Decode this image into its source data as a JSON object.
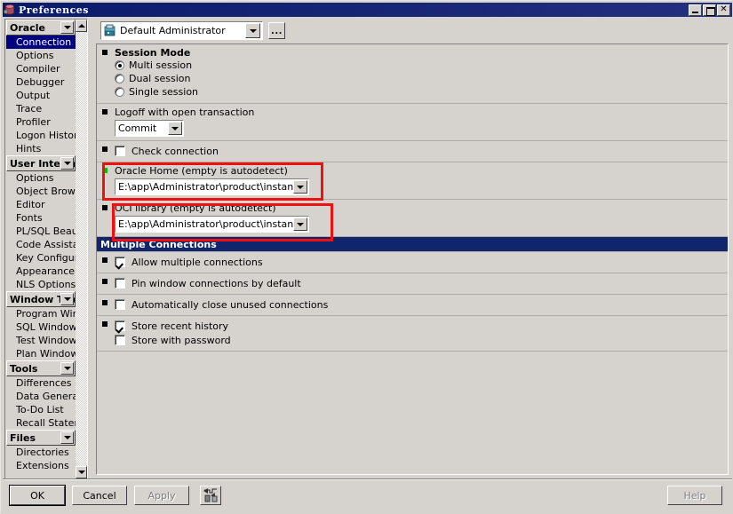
{
  "window": {
    "title": "Preferences",
    "icon": "database-icon",
    "controls": {
      "minimize": "minimize-icon",
      "maximize": "maximize-icon",
      "close": "close-icon"
    }
  },
  "sidebar": {
    "groups": [
      {
        "label": "Oracle",
        "items": [
          {
            "label": "Connection",
            "selected": true
          },
          {
            "label": "Options",
            "selected": false
          },
          {
            "label": "Compiler",
            "selected": false
          },
          {
            "label": "Debugger",
            "selected": false
          },
          {
            "label": "Output",
            "selected": false
          },
          {
            "label": "Trace",
            "selected": false
          },
          {
            "label": "Profiler",
            "selected": false
          },
          {
            "label": "Logon History",
            "selected": false
          },
          {
            "label": "Hints",
            "selected": false
          }
        ]
      },
      {
        "label": "User Interfa",
        "items": [
          {
            "label": "Options",
            "selected": false
          },
          {
            "label": "Object Browser",
            "selected": false
          },
          {
            "label": "Editor",
            "selected": false
          },
          {
            "label": "Fonts",
            "selected": false
          },
          {
            "label": "PL/SQL Beautifi",
            "selected": false
          },
          {
            "label": "Code Assistant",
            "selected": false
          },
          {
            "label": "Key Configurat",
            "selected": false
          },
          {
            "label": "Appearance",
            "selected": false
          },
          {
            "label": "NLS Options",
            "selected": false
          }
        ]
      },
      {
        "label": "Window Type",
        "items": [
          {
            "label": "Program Windo",
            "selected": false
          },
          {
            "label": "SQL Window",
            "selected": false
          },
          {
            "label": "Test Window",
            "selected": false
          },
          {
            "label": "Plan Window",
            "selected": false
          }
        ]
      },
      {
        "label": "Tools",
        "items": [
          {
            "label": "Differences",
            "selected": false
          },
          {
            "label": "Data Generator",
            "selected": false
          },
          {
            "label": "To-Do List",
            "selected": false
          },
          {
            "label": "Recall Statemen",
            "selected": false
          }
        ]
      },
      {
        "label": "Files",
        "items": [
          {
            "label": "Directories",
            "selected": false
          },
          {
            "label": "Extensions",
            "selected": false
          }
        ]
      }
    ],
    "scrollbar": {
      "up": "scroll-up-arrow-icon",
      "down": "scroll-down-arrow-icon"
    }
  },
  "toolbar": {
    "profile_value": "Default Administrator",
    "profile_icon": "user-profile-icon",
    "dropdown_arrow": "chevron-down-icon",
    "browse_label": "..."
  },
  "main": {
    "session_mode": {
      "title": "Session Mode",
      "options": [
        {
          "label": "Multi session",
          "checked": true
        },
        {
          "label": "Dual session",
          "checked": false
        },
        {
          "label": "Single session",
          "checked": false
        }
      ]
    },
    "logoff": {
      "title": "Logoff with open transaction",
      "value": "Commit"
    },
    "check_connection": {
      "label": "Check connection",
      "checked": false
    },
    "oracle_home": {
      "title": "Oracle Home (empty is autodetect)",
      "value": "E:\\app\\Administrator\\product\\instantclie",
      "highlighted": true,
      "marker_color": "#00c000"
    },
    "oci_library": {
      "title": "OCI library (empty is autodetect)",
      "value": "E:\\app\\Administrator\\product\\instantclie",
      "highlighted": true
    },
    "multiple_connections": {
      "header": "Multiple Connections",
      "header_color": "#11246e",
      "items": [
        {
          "label": "Allow multiple connections",
          "checked": true
        },
        {
          "label": "Pin window connections by default",
          "checked": false
        },
        {
          "label": "Automatically close unused connections",
          "checked": false
        },
        {
          "label": "Store recent history",
          "checked": true
        },
        {
          "label": "Store with password",
          "checked": false,
          "indent": true
        }
      ]
    }
  },
  "footer": {
    "ok": "OK",
    "cancel": "Cancel",
    "apply": "Apply",
    "apply_disabled": true,
    "import_export_icon": "import-export-icon",
    "help": "Help",
    "help_disabled": true
  },
  "annotations": {
    "highlight_color": "#ee1111"
  }
}
